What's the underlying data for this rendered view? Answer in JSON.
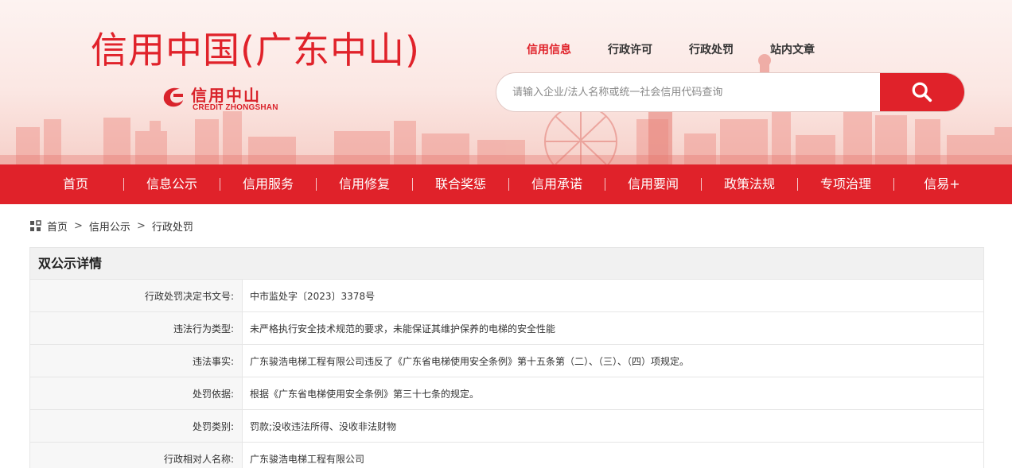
{
  "header": {
    "site_title": "信用中国(广东中山)",
    "logo_cn": "信用中山",
    "logo_en": "CREDIT ZHONGSHAN"
  },
  "top_nav": {
    "items": [
      "信用信息",
      "行政许可",
      "行政处罚",
      "站内文章"
    ],
    "active": "信用信息"
  },
  "search": {
    "placeholder": "请输入企业/法人名称或统一社会信用代码查询",
    "button_icon": "search-icon"
  },
  "main_nav": {
    "items": [
      "首页",
      "信息公示",
      "信用服务",
      "信用修复",
      "联合奖惩",
      "信用承诺",
      "信用要闻",
      "政策法规",
      "专项治理",
      "信易+"
    ]
  },
  "breadcrumb": {
    "icon": "grid-icon",
    "items": [
      "首页",
      "信用公示",
      "行政处罚"
    ],
    "separator": ">"
  },
  "detail": {
    "title": "双公示详情",
    "rows": [
      {
        "label": "行政处罚决定书文号:",
        "value": "中市监处字〔2023〕3378号"
      },
      {
        "label": "违法行为类型:",
        "value": "未严格执行安全技术规范的要求，未能保证其维护保养的电梯的安全性能"
      },
      {
        "label": "违法事实:",
        "value": "广东骏浩电梯工程有限公司违反了《广东省电梯使用安全条例》第十五条第（二）、（三）、（四）项规定。"
      },
      {
        "label": "处罚依据:",
        "value": "根据《广东省电梯使用安全条例》第三十七条的规定。"
      },
      {
        "label": "处罚类别:",
        "value": "罚款;没收违法所得、没收非法财物"
      },
      {
        "label": "行政相对人名称:",
        "value": "广东骏浩电梯工程有限公司"
      }
    ]
  },
  "colors": {
    "brand_red": "#e0222a",
    "banner_bg": "#fbe7e3",
    "table_label_bg": "#f7f7f7",
    "panel_title_bg": "#f1f1f1"
  }
}
